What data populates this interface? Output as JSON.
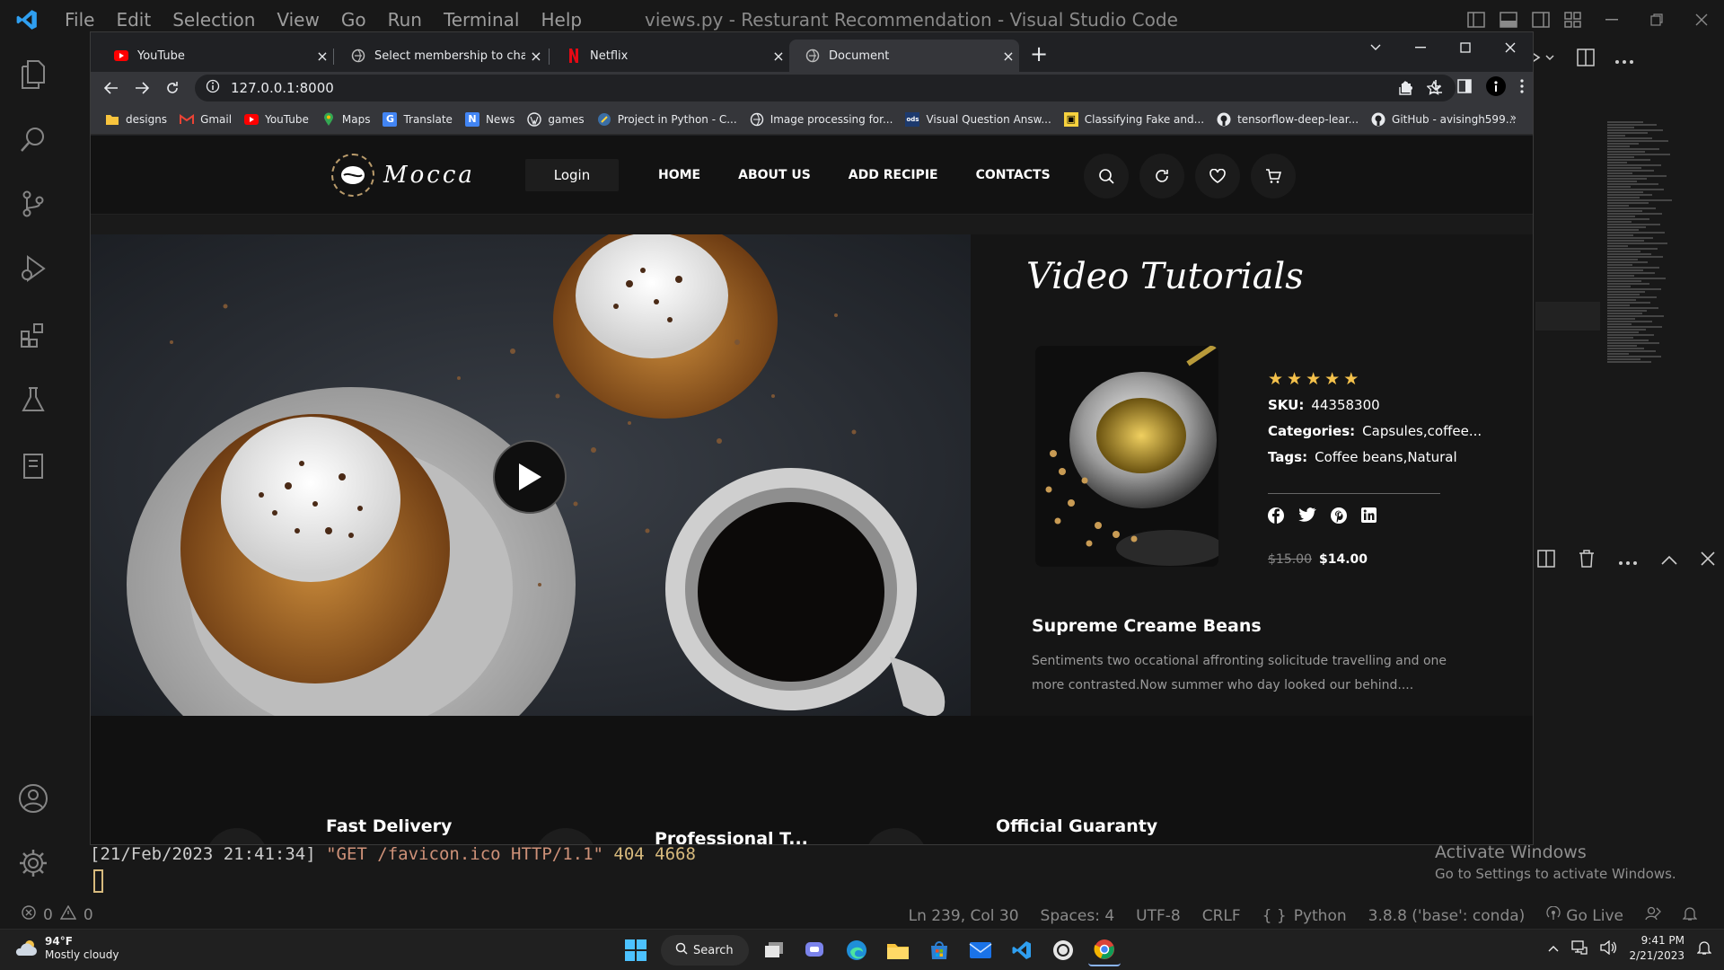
{
  "vscode": {
    "menu": [
      "File",
      "Edit",
      "Selection",
      "View",
      "Go",
      "Run",
      "Terminal",
      "Help"
    ],
    "window_title": "views.py - Resturant Recommendation - Visual Studio Code"
  },
  "browser": {
    "tabs": [
      {
        "label": "YouTube",
        "icon": "youtube-icon"
      },
      {
        "label": "Select membership to change | Djan",
        "icon": "globe-icon"
      },
      {
        "label": "Netflix",
        "icon": "netflix-icon"
      },
      {
        "label": "Document",
        "icon": "globe-icon",
        "active": true
      }
    ],
    "url": "127.0.0.1:8000",
    "bookmarks": [
      "designs",
      "Gmail",
      "YouTube",
      "Maps",
      "Translate",
      "News",
      "games",
      "Project in Python - C...",
      "Image processing for...",
      "Visual Question Answ...",
      "Classifying Fake and...",
      "tensorflow-deep-lear...",
      "GitHub - avisingh599..."
    ]
  },
  "site": {
    "logo_text": "Mocca",
    "login_label": "Login",
    "nav": [
      "HOME",
      "ABOUT US",
      "ADD RECIPIE",
      "CONTACTS"
    ],
    "section_title": "Video Tutorials",
    "rating": 5,
    "sku_label": "SKU:",
    "sku_value": "44358300",
    "categories_label": "Categories:",
    "categories_value": "Capsules,coffee...",
    "tags_label": "Tags:",
    "tags_value": "Coffee beans,Natural",
    "old_price": "$15.00",
    "price": "$14.00",
    "product_name": "Supreme Creame Beans",
    "product_desc": "Sentiments two occational affronting solicitude travelling and one more contrasted.Now summer who day looked our behind....",
    "features": [
      "Fast Delivery",
      "Professional T...",
      "Official Guaranty"
    ]
  },
  "terminal": {
    "prefix": "[21/Feb/2023 21:41:34] ",
    "request": "\"GET /favicon.ico HTTP/1.1\"",
    "code": " 404 4668"
  },
  "watermark": {
    "line1": "Activate Windows",
    "line2": "Go to Settings to activate Windows."
  },
  "statusbar": {
    "errors": "0",
    "warnings": "0",
    "position": "Ln 239, Col 30",
    "spaces": "Spaces: 4",
    "encoding": "UTF-8",
    "eol": "CRLF",
    "language": "Python",
    "interpreter": "3.8.8 ('base': conda)",
    "golive": "Go Live"
  },
  "taskbar": {
    "temp": "94°F",
    "weather": "Mostly cloudy",
    "search": "Search",
    "time": "9:41 PM",
    "date": "2/21/2023"
  }
}
